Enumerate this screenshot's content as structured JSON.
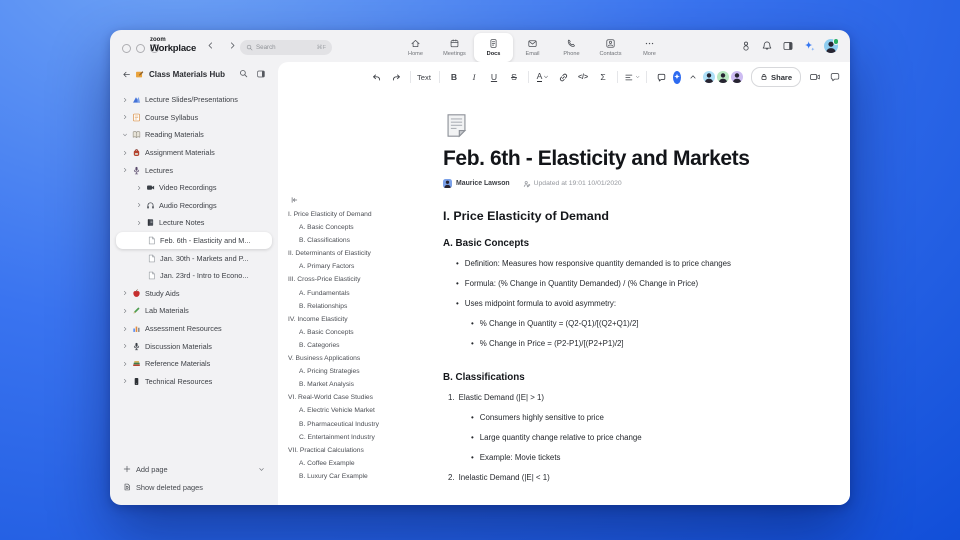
{
  "topbar": {
    "brand": {
      "line1": "zoom",
      "line2": "Workplace"
    },
    "search": {
      "placeholder": "Search",
      "shortcut": "⌘F"
    },
    "tabs": [
      {
        "label": "Home",
        "icon": "home-icon",
        "active": false
      },
      {
        "label": "Meetings",
        "icon": "meetings-icon",
        "active": false
      },
      {
        "label": "Docs",
        "icon": "docs-icon",
        "active": true
      },
      {
        "label": "Email",
        "icon": "email-icon",
        "active": false
      },
      {
        "label": "Phone",
        "icon": "phone-icon",
        "active": false
      },
      {
        "label": "Contacts",
        "icon": "contacts-icon",
        "active": false
      },
      {
        "label": "More",
        "icon": "more-icon",
        "active": false
      }
    ]
  },
  "sidebar": {
    "title": "Class Materials Hub",
    "items": [
      {
        "label": "Lecture Slides/Presentations",
        "icon": "slides-icon",
        "depth": 0,
        "chevron": "right",
        "selected": false
      },
      {
        "label": "Course Syllabus",
        "icon": "syllabus-icon",
        "depth": 0,
        "chevron": "right",
        "selected": false
      },
      {
        "label": "Reading Materials",
        "icon": "book-icon",
        "depth": 0,
        "chevron": "down",
        "selected": false
      },
      {
        "label": "Assignment Materials",
        "icon": "backpack-icon",
        "depth": 0,
        "chevron": "right",
        "selected": false
      },
      {
        "label": "Lectures",
        "icon": "lecture-icon",
        "depth": 0,
        "chevron": "right",
        "selected": false
      },
      {
        "label": "Video Recordings",
        "icon": "video-icon",
        "depth": 1,
        "chevron": "right",
        "selected": false
      },
      {
        "label": "Audio Recordings",
        "icon": "audio-icon",
        "depth": 1,
        "chevron": "right",
        "selected": false
      },
      {
        "label": "Lecture Notes",
        "icon": "notebook-icon",
        "depth": 1,
        "chevron": "right",
        "selected": false
      },
      {
        "label": "Feb. 6th - Elasticity and M...",
        "icon": "page-icon",
        "depth": 2,
        "chevron": "none",
        "selected": true
      },
      {
        "label": "Jan. 30th - Markets and P...",
        "icon": "page-icon",
        "depth": 2,
        "chevron": "none",
        "selected": false
      },
      {
        "label": "Jan. 23rd - Intro to Econo...",
        "icon": "page-icon",
        "depth": 2,
        "chevron": "none",
        "selected": false
      },
      {
        "label": "Study Aids",
        "icon": "apple-icon",
        "depth": 0,
        "chevron": "right",
        "selected": false
      },
      {
        "label": "Lab Materials",
        "icon": "pencil-icon",
        "depth": 0,
        "chevron": "right",
        "selected": false
      },
      {
        "label": "Assessment Resources",
        "icon": "chart-icon",
        "depth": 0,
        "chevron": "right",
        "selected": false
      },
      {
        "label": "Discussion Materials",
        "icon": "mic-icon",
        "depth": 0,
        "chevron": "right",
        "selected": false
      },
      {
        "label": "Reference Materials",
        "icon": "books-icon",
        "depth": 0,
        "chevron": "right",
        "selected": false
      },
      {
        "label": "Technical Resources",
        "icon": "device-icon",
        "depth": 0,
        "chevron": "right",
        "selected": false
      }
    ],
    "footer": {
      "add_page": "Add page",
      "show_deleted": "Show deleted pages"
    }
  },
  "toolbar": {
    "text_style": "Text",
    "bold": "B",
    "italic": "I",
    "underline": "U",
    "strikethrough": "S",
    "text_color": "A",
    "code": "</>",
    "formula": "Σ",
    "share": "Share"
  },
  "outline": {
    "items": [
      {
        "text": "I. Price Elasticity of Demand",
        "depth": 0
      },
      {
        "text": "A. Basic Concepts",
        "depth": 1
      },
      {
        "text": "B. Classifications",
        "depth": 1
      },
      {
        "text": "II. Determinants of Elasticity",
        "depth": 0
      },
      {
        "text": "A. Primary Factors",
        "depth": 1
      },
      {
        "text": "III. Cross-Price Elasticity",
        "depth": 0
      },
      {
        "text": "A. Fundamentals",
        "depth": 1
      },
      {
        "text": "B. Relationships",
        "depth": 1
      },
      {
        "text": "IV. Income Elasticity",
        "depth": 0
      },
      {
        "text": "A. Basic Concepts",
        "depth": 1
      },
      {
        "text": "B. Categories",
        "depth": 1
      },
      {
        "text": "V. Business Applications",
        "depth": 0
      },
      {
        "text": "A. Pricing Strategies",
        "depth": 1
      },
      {
        "text": "B. Market Analysis",
        "depth": 1
      },
      {
        "text": "VI. Real-World Case Studies",
        "depth": 0
      },
      {
        "text": "A. Electric Vehicle Market",
        "depth": 1
      },
      {
        "text": "B. Pharmaceutical Industry",
        "depth": 1
      },
      {
        "text": "C. Entertainment Industry",
        "depth": 1
      },
      {
        "text": "VII. Practical Calculations",
        "depth": 0
      },
      {
        "text": "A. Coffee Example",
        "depth": 1
      },
      {
        "text": "B. Luxury Car Example",
        "depth": 1
      }
    ]
  },
  "doc": {
    "title": "Feb. 6th - Elasticity and Markets",
    "author": "Maurice Lawson",
    "updated": "Updated at 19:01 10/01/2020",
    "blocks": [
      {
        "type": "h2",
        "text": "I. Price Elasticity of Demand"
      },
      {
        "type": "h3",
        "text": "A. Basic Concepts"
      },
      {
        "type": "bullet",
        "depth": 1,
        "text": "Definition: Measures how responsive quantity demanded is to price changes"
      },
      {
        "type": "bullet",
        "depth": 1,
        "text": "Formula: (% Change in Quantity Demanded) / (% Change in Price)"
      },
      {
        "type": "bullet",
        "depth": 1,
        "text": "Uses midpoint formula to avoid asymmetry:"
      },
      {
        "type": "bullet",
        "depth": 2,
        "text": "% Change in Quantity = (Q2-Q1)/[(Q2+Q1)/2]"
      },
      {
        "type": "bullet",
        "depth": 2,
        "text": "% Change in Price = (P2-P1)/[(P2+P1)/2]"
      },
      {
        "type": "h3",
        "text": "B. Classifications",
        "extra_top": true
      },
      {
        "type": "num",
        "marker": "1.",
        "text": "Elastic Demand (|E| > 1)"
      },
      {
        "type": "bullet",
        "depth": 2,
        "text": "Consumers highly sensitive to price"
      },
      {
        "type": "bullet",
        "depth": 2,
        "text": "Large quantity change relative to price change"
      },
      {
        "type": "bullet",
        "depth": 2,
        "text": "Example: Movie tickets"
      },
      {
        "type": "num",
        "marker": "2.",
        "text": "Inelastic Demand (|E| < 1)"
      }
    ]
  },
  "colors": {
    "accent": "#0B5CFF",
    "ai_blue": "#2E6BF0",
    "collab_avatar_bgs": [
      "#aee0f8",
      "#b9e8c0",
      "#cdbcf2"
    ]
  }
}
